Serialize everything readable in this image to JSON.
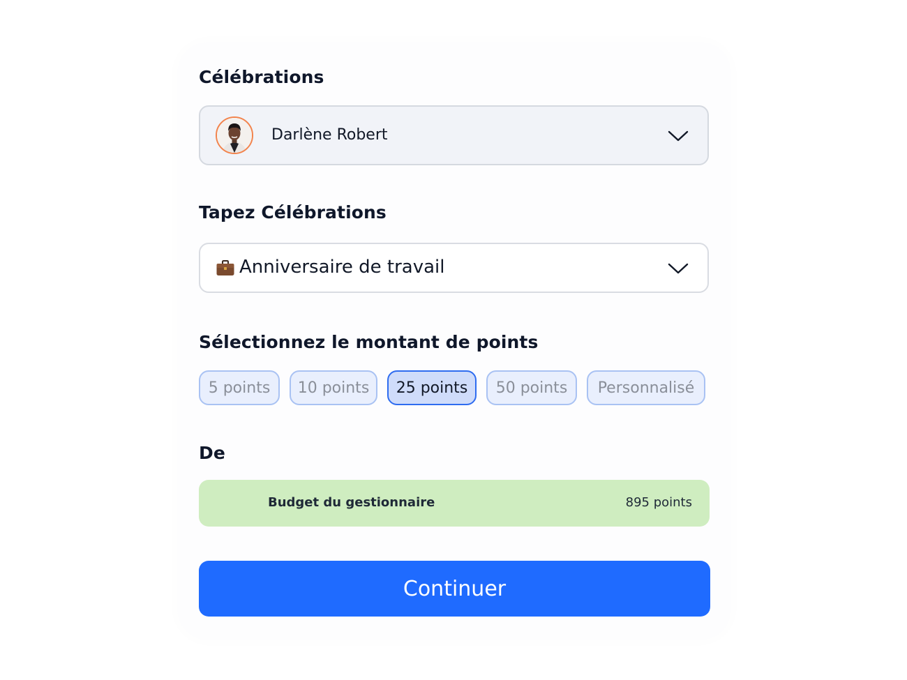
{
  "recipient": {
    "label": "Célébrations",
    "selected_name": "Darlène Robert",
    "avatar_border_color": "#f2834c",
    "chevron_icon": "chevron-down-icon"
  },
  "celebration_type": {
    "label": "Tapez Célébrations",
    "selected_value": "Anniversaire de travail",
    "icon": "briefcase-icon",
    "chevron_icon": "chevron-down-icon"
  },
  "points": {
    "label": "Sélectionnez le montant de points",
    "options": [
      "5 points",
      "10 points",
      "25 points",
      "50 points",
      "Personnalisé"
    ],
    "selected_option": "25 points"
  },
  "from": {
    "label": "De",
    "budget_name": "Budget du gestionnaire",
    "budget_amount": "895 points",
    "budget_bg_color": "#cfedc0"
  },
  "actions": {
    "continue_label": "Continuer",
    "continue_color": "#1f6bff"
  }
}
